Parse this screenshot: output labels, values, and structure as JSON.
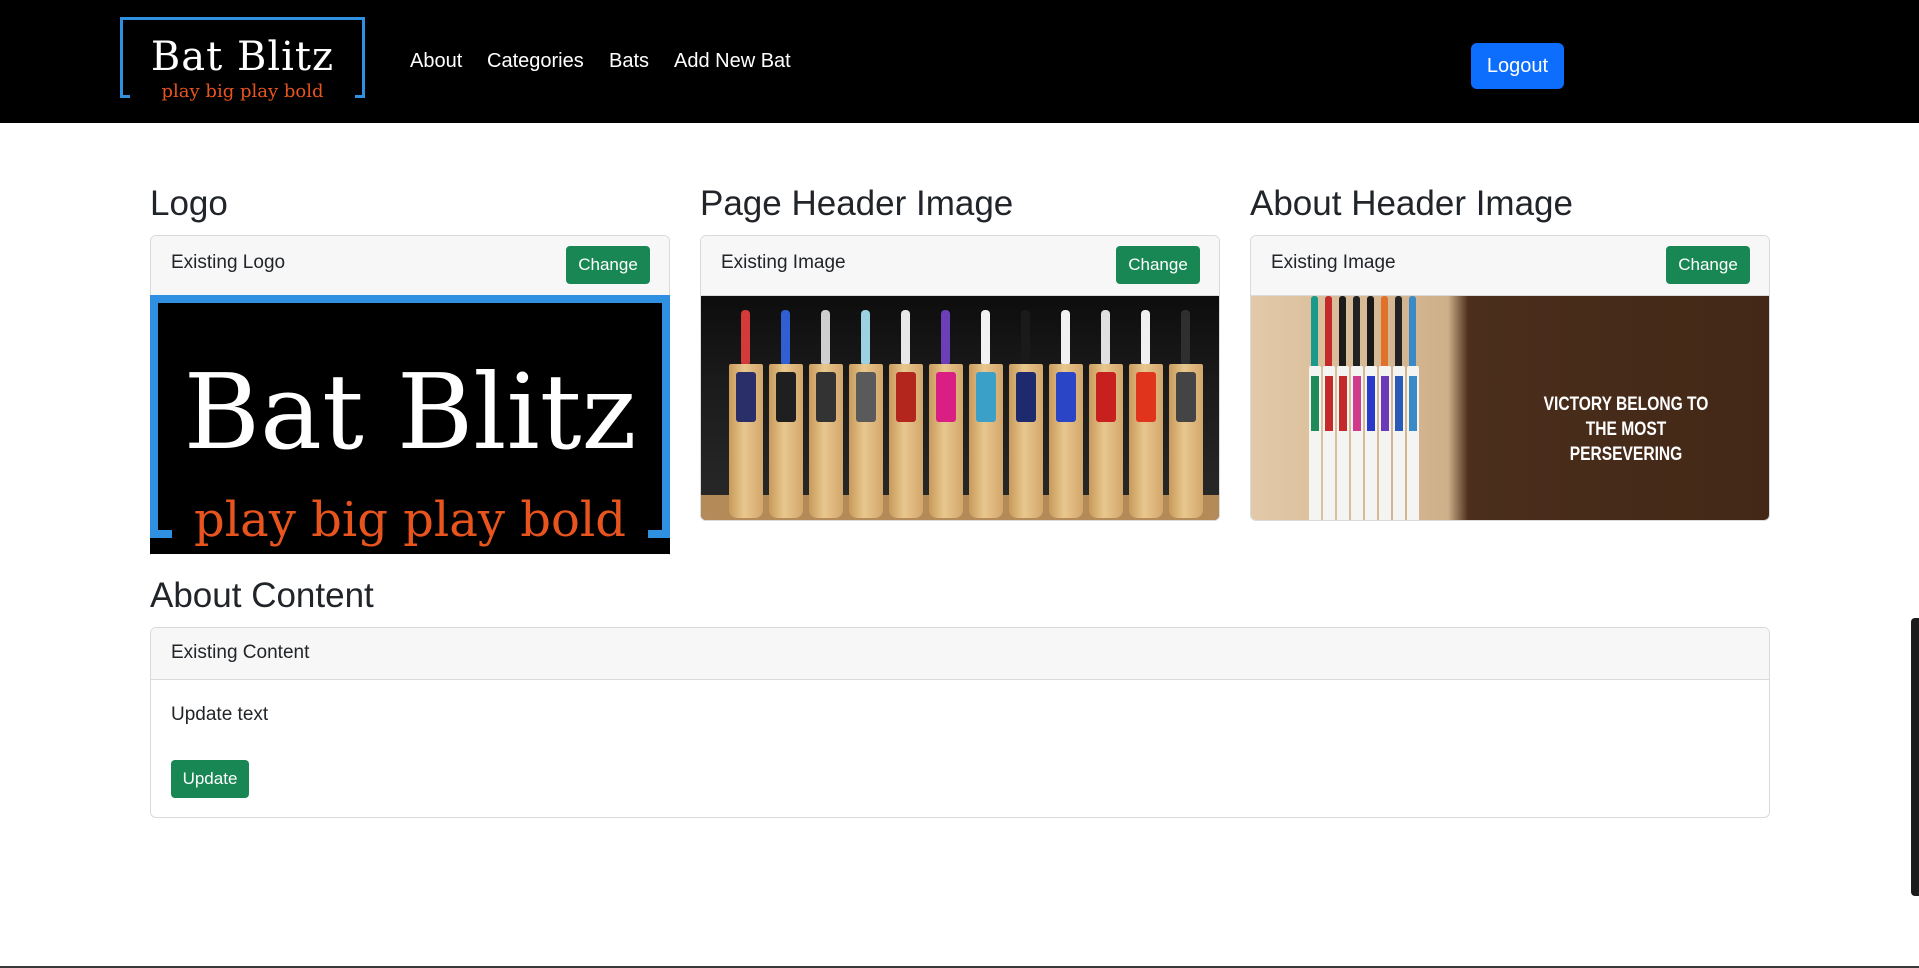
{
  "brand": {
    "title": "Bat Blitz",
    "tagline": "play big play bold"
  },
  "nav": {
    "links": [
      {
        "label": "About"
      },
      {
        "label": "Categories"
      },
      {
        "label": "Bats"
      },
      {
        "label": "Add New Bat"
      }
    ],
    "logout_label": "Logout"
  },
  "sections": {
    "logo": {
      "title": "Logo",
      "header_label": "Existing Logo",
      "change_label": "Change",
      "preview_title": "Bat Blitz",
      "preview_tagline": "play big play bold"
    },
    "page_header_image": {
      "title": "Page Header Image",
      "header_label": "Existing Image",
      "change_label": "Change"
    },
    "about_header_image": {
      "title": "About Header Image",
      "header_label": "Existing Image",
      "change_label": "Change",
      "image_caption": "VICTORY BELONG TO THE MOST PERSEVERING"
    },
    "about_content": {
      "title": "About Content",
      "header_label": "Existing Content",
      "body_text": "Update text",
      "update_label": "Update"
    }
  },
  "colors": {
    "navbar_bg": "#000000",
    "primary": "#0d6efd",
    "success": "#198754",
    "brand_blue": "#2f8fe0",
    "brand_orange": "#e8541e"
  },
  "icons": []
}
